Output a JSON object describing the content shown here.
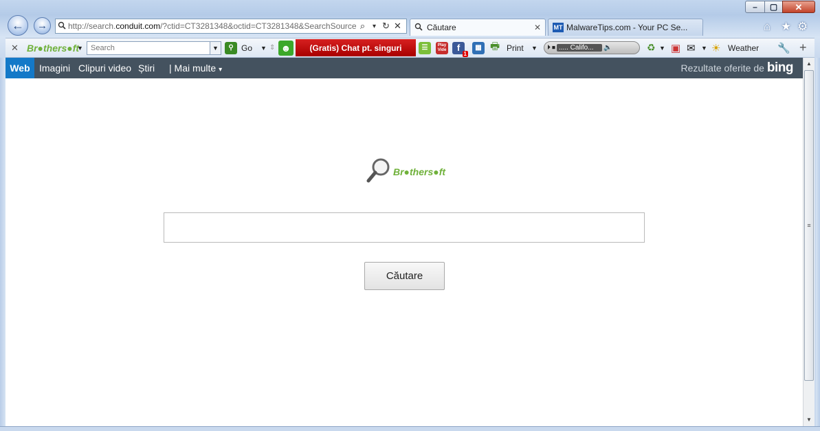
{
  "window": {
    "controls": {
      "minimize": "–",
      "maximize": "▢",
      "close": "✕"
    }
  },
  "nav": {
    "back_icon": "←",
    "forward_icon": "→"
  },
  "address_bar": {
    "url_prefix": "http://search.",
    "url_domain": "conduit.com",
    "url_suffix": "/?ctid=CT3281348&octid=CT3281348&SearchSource",
    "tools": [
      "⌕",
      "▾",
      "↻",
      "✕"
    ]
  },
  "tabs": [
    {
      "label": "Căutare",
      "close": "✕",
      "icon": "search-icon"
    },
    {
      "label": "MalwareTips.com - Your PC Se...",
      "icon_text": "MT"
    }
  ],
  "toolbar": {
    "close": "✕",
    "brand": "Br●thers●ft",
    "search_placeholder": "Search",
    "go_label": "Go",
    "chat_label": "(Gratis) Chat pt. singuri",
    "print_label": "Print",
    "radio_station": "..... Califo...",
    "weather_label": "Weather",
    "play_video": "Play Vide",
    "fb_badge": "1"
  },
  "bing_nav": {
    "items": [
      "Web",
      "Imagini",
      "Clipuri video",
      "Știri",
      "| Mai multe"
    ],
    "more_arrow": "▾",
    "powered_by": "Rezultate oferite de",
    "bing_logo": "bing"
  },
  "page": {
    "logo_text": "Br●thers●ft",
    "search_value": "",
    "search_button": "Căutare"
  },
  "colors": {
    "bing_bar": "#44525f",
    "web_tab": "#1479c8",
    "chat_button": "#c00000"
  }
}
